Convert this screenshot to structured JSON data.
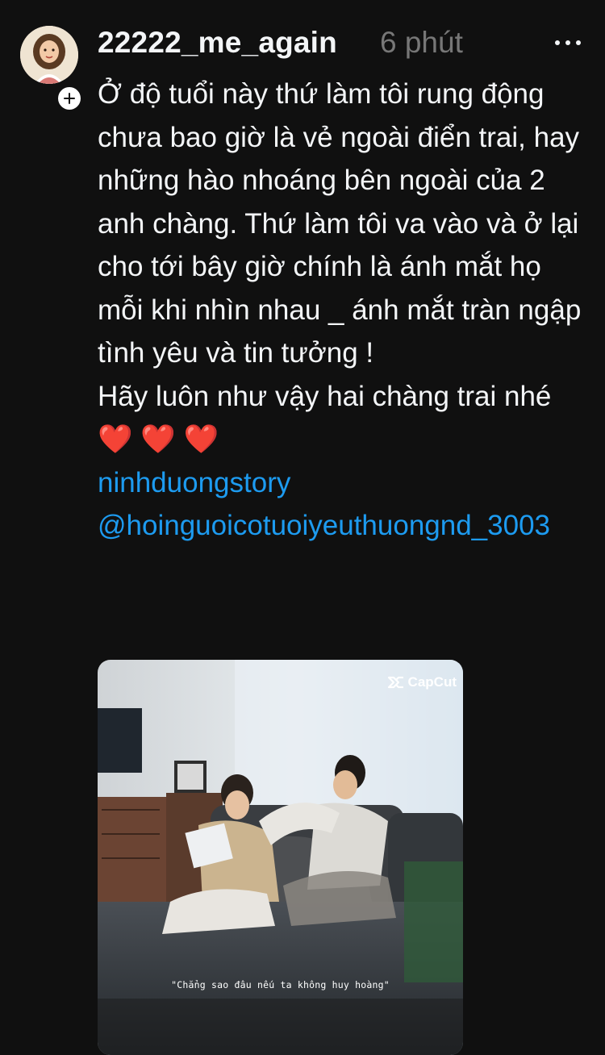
{
  "post": {
    "username": "22222_me_again",
    "timestamp": "6 phút",
    "body_paragraph_1": "Ở độ tuổi này thứ làm tôi rung động chưa bao giờ là vẻ ngoài điển trai, hay những hào nhoáng bên ngoài của 2 anh chàng. Thứ làm tôi va vào và ở lại cho tới bây giờ chính là ánh mắt họ mỗi khi nhìn nhau _ ánh mắt tràn ngập tình yêu và tin tưởng !",
    "body_paragraph_2": "Hãy luôn như vậy hai chàng trai nhé",
    "hearts": "❤️ ❤️ ❤️",
    "tag": "ninhduongstory",
    "mention": "@hoinguoicotuoiyeuthuongnd_3003",
    "icons": {
      "avatar": "profile-avatar",
      "follow": "plus-icon",
      "more": "more-dots-icon",
      "watermark": "capcut-logo-icon"
    },
    "media": {
      "watermark_text": "CapCut",
      "subtitle": "\"Chẳng sao đâu nếu ta không huy hoàng\""
    }
  },
  "colors": {
    "background": "#101010",
    "text_primary": "#f3f5f7",
    "text_secondary": "#777777",
    "link": "#1d9bf0",
    "heart": "#ff2d3d"
  }
}
